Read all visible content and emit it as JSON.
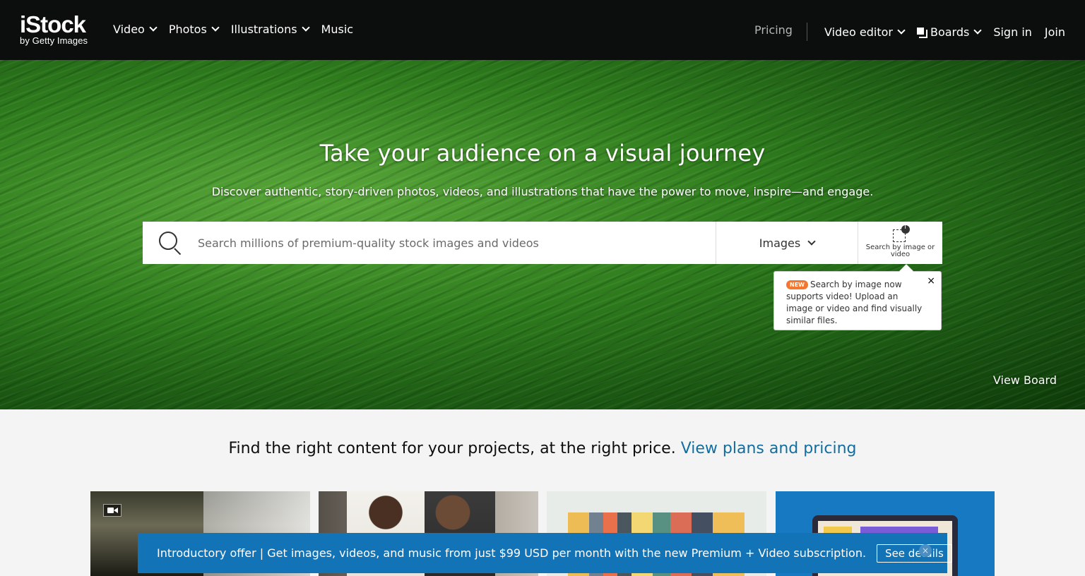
{
  "brand": {
    "name": "iStock",
    "tagline": "by Getty Images"
  },
  "nav": {
    "left": [
      {
        "label": "Video",
        "dropdown": true
      },
      {
        "label": "Photos",
        "dropdown": true
      },
      {
        "label": "Illustrations",
        "dropdown": true
      },
      {
        "label": "Music",
        "dropdown": false
      }
    ],
    "pricing": "Pricing",
    "video_editor": "Video editor",
    "boards": "Boards",
    "sign_in": "Sign in",
    "join": "Join"
  },
  "hero": {
    "title": "Take your audience on a visual journey",
    "subtitle": "Discover authentic, story-driven photos, videos, and illustrations that have the power to move, inspire—and engage.",
    "search_placeholder": "Search millions of premium-quality stock images and videos",
    "search_type": "Images",
    "search_by_image_label": "Search by image or video",
    "view_board": "View Board"
  },
  "popover": {
    "badge": "NEW",
    "text": "Search by image now supports video! Upload an image or video and find visually similar files.",
    "close": "×"
  },
  "promo": {
    "text": "Find the right content for your projects, at the right price.",
    "link": "View plans and pricing"
  },
  "offer": {
    "text": "Introductory offer | Get images, videos, and music from just $99 USD per month with the new Premium + Video subscription.",
    "button": "See details",
    "close": "×"
  },
  "colors": {
    "nav_bg": "#0c0d0d",
    "link_blue": "#116ea0",
    "offer_bg": "#1273b6",
    "badge_orange": "#f1782e"
  }
}
